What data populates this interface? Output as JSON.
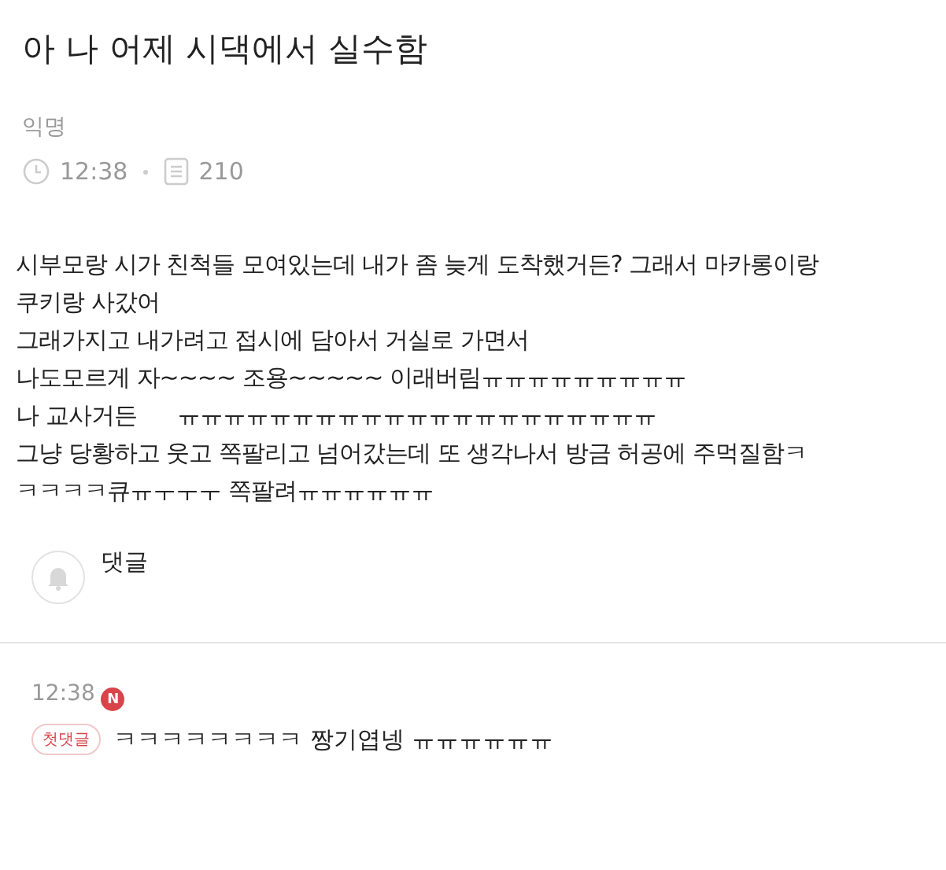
{
  "post": {
    "title": "아 나 어제 시댁에서 실수함",
    "author": "익명",
    "time": "12:38",
    "views": "210",
    "body": [
      "시부모랑 시가 친척들 모여있는데 내가 좀 늦게 도착했거든? 그래서 마카롱이랑",
      "쿠키랑 사갔어",
      "그래가지고 내가려고 접시에 담아서 거실로 가면서",
      "나도모르게 자~~~~ 조용~~~~~ 이래버림ㅠㅠㅠㅠㅠㅠㅠㅠㅠ",
      "나 교사거든      ㅠㅠㅠㅠㅠㅠㅠㅠㅠㅠㅠㅠㅠㅠㅠㅠㅠㅠㅠㅠㅠ",
      "그냥 당황하고 웃고 쪽팔리고 넘어갔는데 또 생각나서 방금 허공에 주먹질함ㅋ",
      "ㅋㅋㅋㅋ큐ㅠㅜㅜㅜ 쪽팔려ㅠㅠㅠㅠㅠㅠ"
    ]
  },
  "comments_header": {
    "label": "댓글"
  },
  "comments": [
    {
      "time": "12:38",
      "new_badge": "N",
      "tag": "첫댓글",
      "text": "ㅋㅋㅋㅋㅋㅋㅋㅋ 짱기엽넹 ㅠㅠㅠㅠㅠㅠ"
    }
  ]
}
